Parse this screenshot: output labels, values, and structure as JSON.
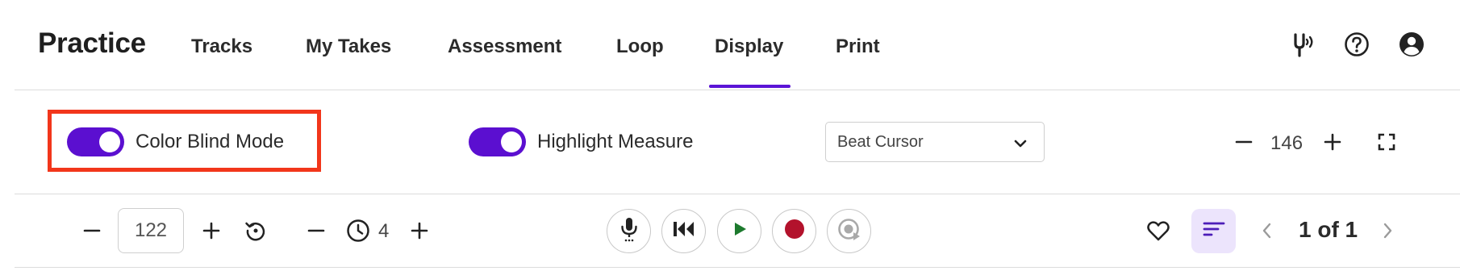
{
  "header": {
    "title": "Practice",
    "tabs": [
      {
        "label": "Tracks"
      },
      {
        "label": "My Takes"
      },
      {
        "label": "Assessment"
      },
      {
        "label": "Loop"
      },
      {
        "label": "Display",
        "active": true
      },
      {
        "label": "Print"
      }
    ],
    "icons": [
      "tuning-fork-icon",
      "help-icon",
      "account-icon"
    ]
  },
  "display": {
    "color_blind_mode": {
      "label": "Color Blind Mode",
      "on": true
    },
    "highlight_measure": {
      "label": "Highlight Measure",
      "on": true
    },
    "cursor_select": {
      "value": "Beat Cursor"
    },
    "zoom_value": "146"
  },
  "transport": {
    "tempo_value": "122",
    "count_in_value": "4",
    "page_indicator": "1 of 1"
  },
  "colors": {
    "accent": "#5b0fd0",
    "highlight_border": "#f2361b",
    "play_green": "#1d7a2e",
    "record_red": "#b3122c",
    "sort_bg": "#ece4fc"
  }
}
